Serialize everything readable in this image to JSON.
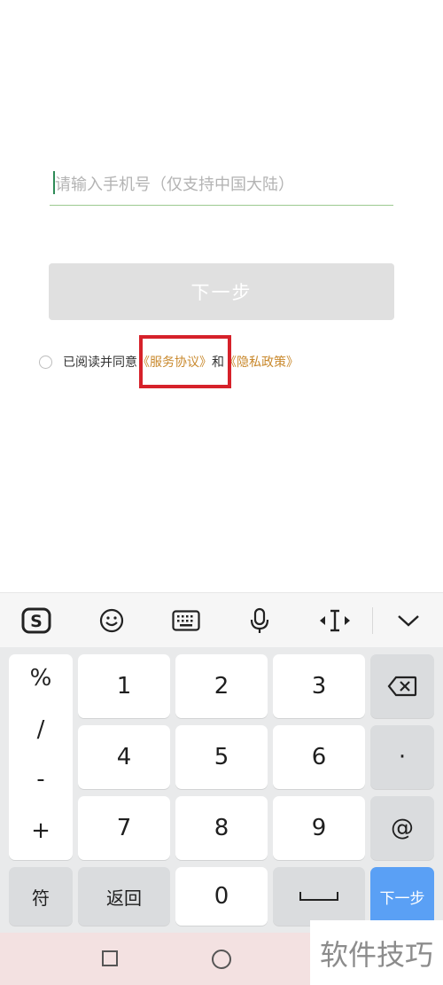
{
  "login": {
    "phone_placeholder": "请输入手机号（仅支持中国大陆）",
    "next_label": "下一步"
  },
  "agreement": {
    "prefix": "已阅读并同意",
    "service_link": "《服务协议》",
    "and": "和",
    "privacy_link": "《隐私政策》"
  },
  "keyboard": {
    "toolbar_icons": [
      "sogou-logo-icon",
      "emoji-icon",
      "keyboard-icon",
      "microphone-icon",
      "cursor-move-icon",
      "collapse-icon"
    ],
    "symbols": [
      "%",
      "/",
      "-",
      "+"
    ],
    "digits": [
      "1",
      "2",
      "3",
      "4",
      "5",
      "6",
      "7",
      "8",
      "9"
    ],
    "zero": "0",
    "dot": "·",
    "at": "@",
    "fu": "符",
    "back": "返回",
    "space": "⎵",
    "next": "下一步"
  },
  "watermark": "软件技巧",
  "colors": {
    "accent_link": "#c9892d",
    "highlight": "#d6212a",
    "next_key": "#5aa0f5",
    "disabled_button": "#e0e0e0"
  }
}
